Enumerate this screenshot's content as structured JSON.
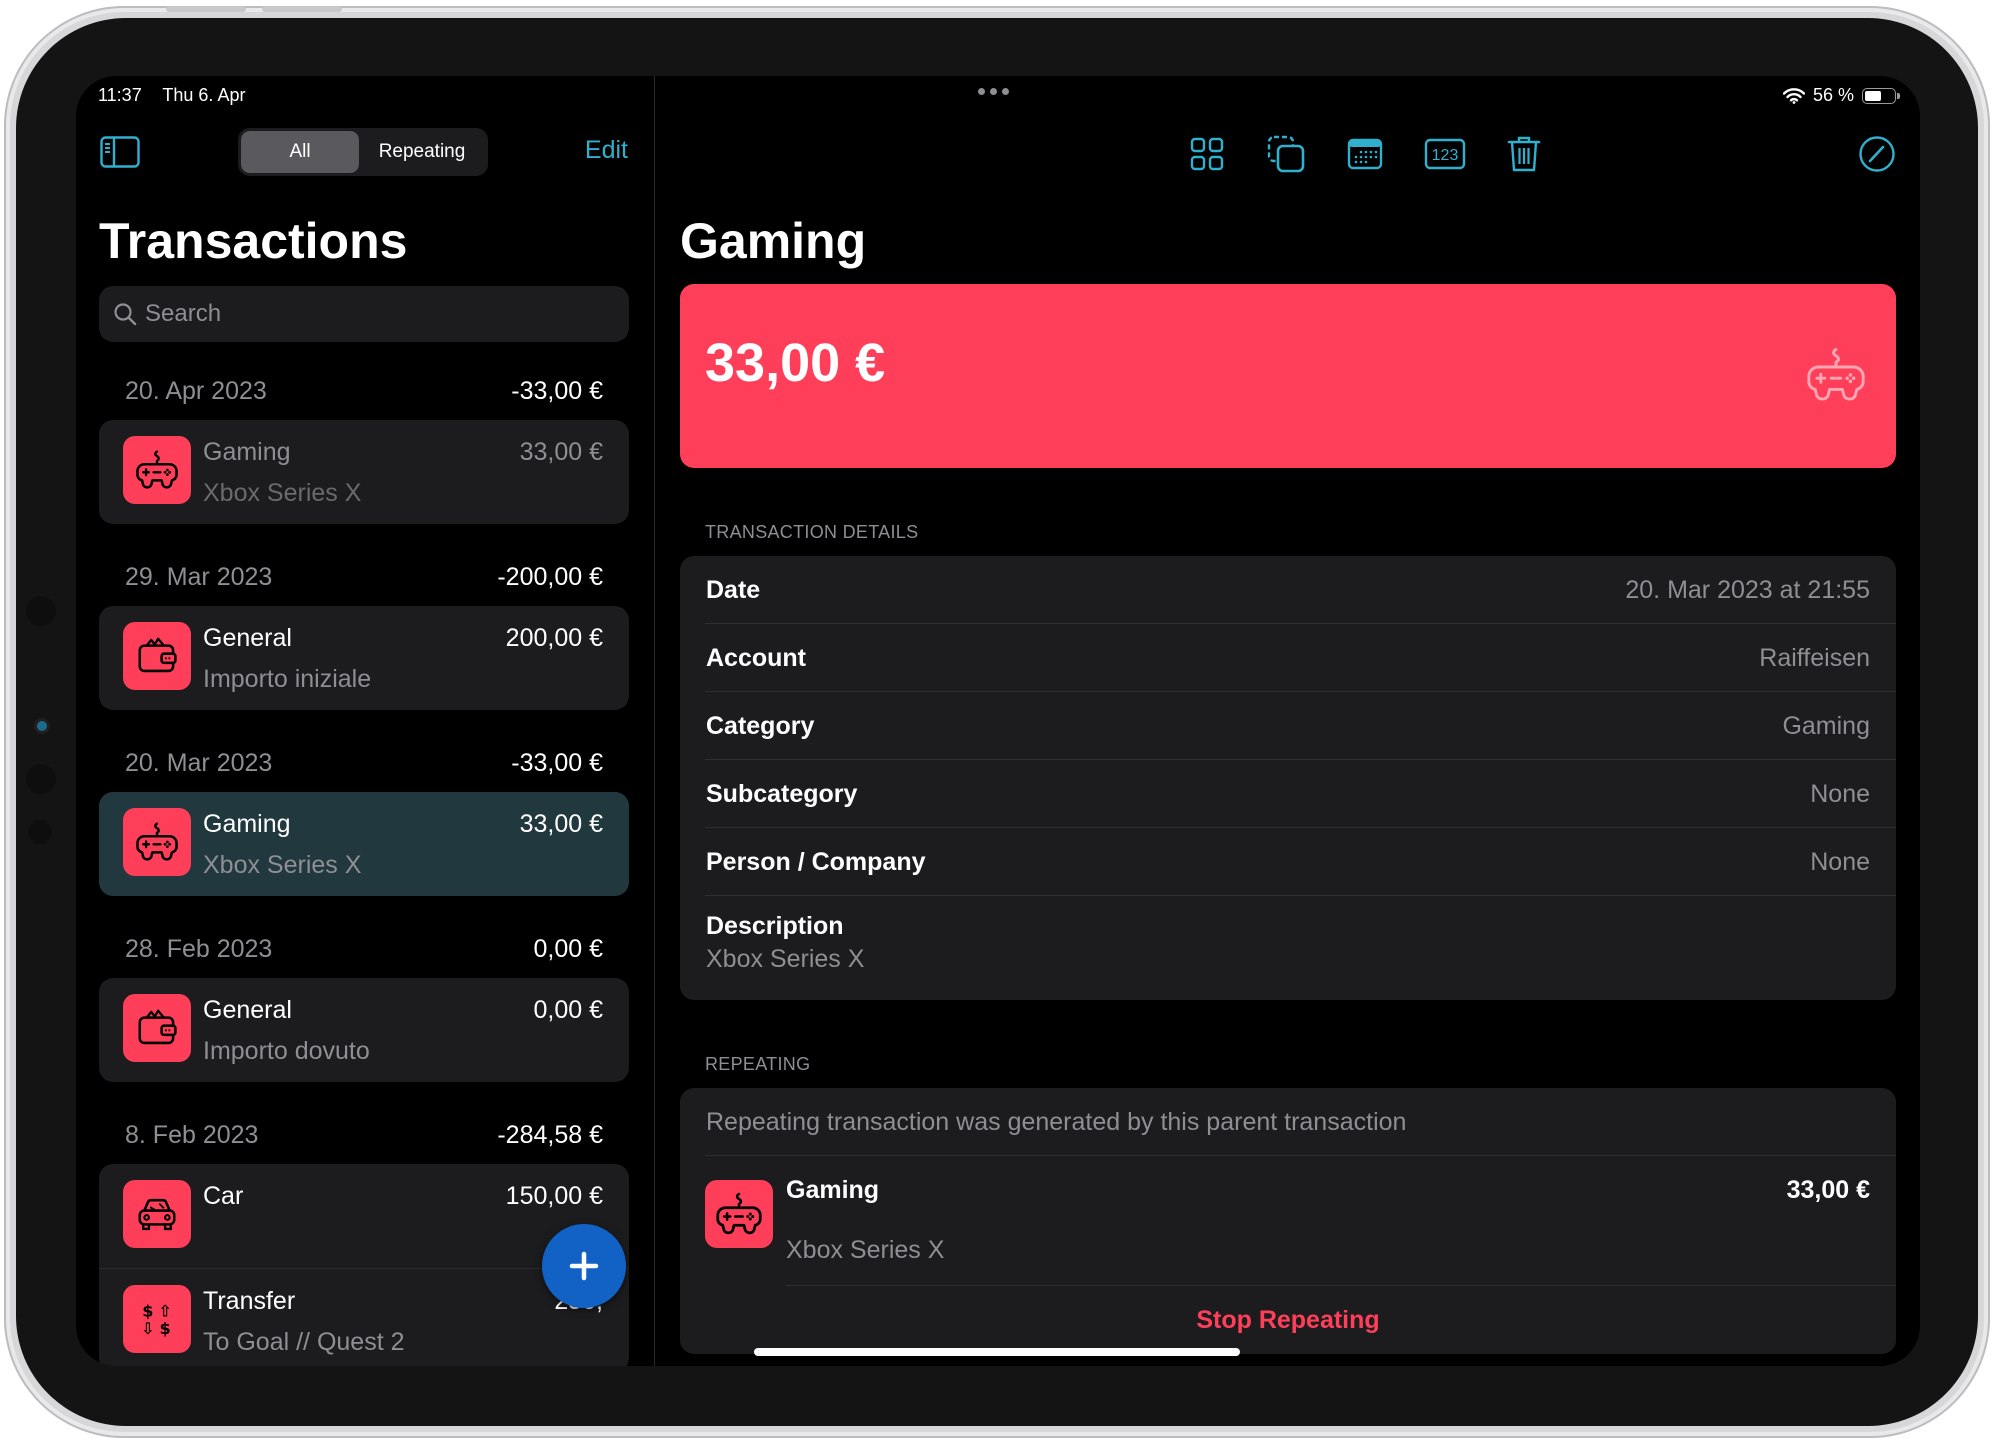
{
  "status_bar": {
    "time": "11:37",
    "date": "Thu 6. Apr",
    "battery_percent_label": "56 %",
    "battery_level": 0.56,
    "icons": [
      "wifi-icon",
      "battery-icon"
    ]
  },
  "sidebar": {
    "toggle_icon": "sidebar-icon",
    "segments": [
      {
        "label": "All",
        "selected": true
      },
      {
        "label": "Repeating",
        "selected": false
      }
    ],
    "edit_label": "Edit",
    "title": "Transactions",
    "search_placeholder": "Search",
    "groups": [
      {
        "date": "20. Apr 2023",
        "total": "-33,00 €",
        "items": [
          {
            "category": "Gaming",
            "description": "Xbox Series X",
            "amount": "33,00 €",
            "icon": "gamepad-icon",
            "dimmed": true,
            "selected": false
          }
        ]
      },
      {
        "date": "29. Mar 2023",
        "total": "-200,00 €",
        "items": [
          {
            "category": "General",
            "description": "Importo iniziale",
            "amount": "200,00 €",
            "icon": "wallet-icon",
            "dimmed": false,
            "selected": false
          }
        ]
      },
      {
        "date": "20. Mar 2023",
        "total": "-33,00 €",
        "items": [
          {
            "category": "Gaming",
            "description": "Xbox Series X",
            "amount": "33,00 €",
            "icon": "gamepad-icon",
            "dimmed": false,
            "selected": true
          }
        ]
      },
      {
        "date": "28. Feb 2023",
        "total": "0,00 €",
        "items": [
          {
            "category": "General",
            "description": "Importo dovuto",
            "amount": "0,00 €",
            "icon": "wallet-icon",
            "dimmed": false,
            "selected": false
          }
        ]
      },
      {
        "date": "8. Feb 2023",
        "total": "-284,58 €",
        "items": [
          {
            "category": "Car",
            "description": "",
            "amount": "150,00 €",
            "icon": "car-icon",
            "dimmed": false,
            "selected": false
          },
          {
            "category": "Transfer",
            "description": "To Goal // Quest 2",
            "amount": "250,",
            "icon": "transfer-icon",
            "dimmed": false,
            "selected": false
          }
        ]
      }
    ],
    "add_button_icon": "plus-icon"
  },
  "toolbar": {
    "icons": [
      "grid-icon",
      "duplicate-icon",
      "calendar-icon",
      "numbers-icon",
      "trash-icon"
    ],
    "right_icons": [
      "edit-pencil-icon",
      "more-icon"
    ]
  },
  "detail": {
    "title": "Gaming",
    "amount": "33,00 €",
    "category_icon": "gamepad-icon",
    "details_header": "TRANSACTION DETAILS",
    "rows": [
      {
        "label": "Date",
        "value": "20. Mar 2023 at 21:55"
      },
      {
        "label": "Account",
        "value": "Raiffeisen"
      },
      {
        "label": "Category",
        "value": "Gaming"
      },
      {
        "label": "Subcategory",
        "value": "None"
      },
      {
        "label": "Person / Company",
        "value": "None"
      }
    ],
    "description_label": "Description",
    "description_value": "Xbox Series X",
    "repeating_header": "REPEATING",
    "repeating_note": "Repeating transaction was generated by this parent transaction",
    "parent": {
      "category": "Gaming",
      "description": "Xbox Series X",
      "amount": "33,00 €",
      "icon": "gamepad-icon"
    },
    "stop_label": "Stop Repeating"
  },
  "colors": {
    "accent": "#2fb0cf",
    "category": "#ff3f59",
    "selected_row": "#20383e",
    "fab": "#1162c4",
    "destructive": "#ff3f59"
  }
}
